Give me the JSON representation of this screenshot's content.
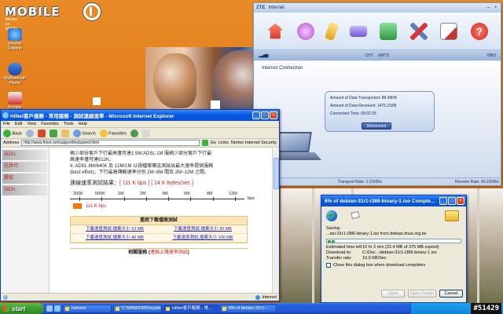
{
  "brand": {
    "logo_text": "MOBILE",
    "logo_sub": "Moves on Mobile"
  },
  "desktop_icons": [
    {
      "label": "Internet Explorer"
    },
    {
      "label": "MyBluetooth Places"
    },
    {
      "label": "Acrobat"
    }
  ],
  "zte": {
    "brand": "ZTE",
    "title": "Internet",
    "status": {
      "operator": "CHT",
      "network": "UMTS",
      "mode": "VIBO"
    },
    "section_label": "Internet Connection",
    "transported": "Amount of Data Transported: 88.48KB",
    "received": "Amount of Data Received: 1475.21KB",
    "time": "Connected Time: 00:02:25",
    "disconnect_label": "Disconnect",
    "footer": {
      "state": "Connected",
      "transport_rate": "Transport Rate: 1.21KB/s",
      "receive_rate": "Receive Rate: 49.23KB/s"
    }
  },
  "ie": {
    "title": "HiNet客戶服務 - 常用服務 - 測試連線速率 - Microsoft Internet Explorer",
    "menu": [
      "File",
      "Edit",
      "View",
      "Favorites",
      "Tools",
      "Help"
    ],
    "toolbar": {
      "back": "Back",
      "search": "Search",
      "favorites": "Favorites"
    },
    "address_label": "Address",
    "url": "http://www.hinet.net/support/testspeed.html",
    "go": "Go",
    "links": "Links",
    "norton": "Norton Internet Security",
    "sidebar": [
      "ADSL",
      "光世代",
      "撥接",
      "ISDN"
    ],
    "content": {
      "line1": "務少部份客戶下行最高僅可達1.5M;ADSL 1M 服務少部分客戶下行最",
      "line2": "高速率僅可達512K。",
      "line3": "4. ADSL 8M/640K 及 12M/1M 以視檔案傳送測試出最大速率提供服務",
      "line4": "(best effort)，下行最高傳輸速率分別 2M~8M 間及 2M~12M 之間。",
      "result_prefix": "連線速率測試結果：",
      "result_value": "[ 111 K bps ] [ 14 K bytes/sec ]",
      "scale_labels": [
        "200K",
        "500K",
        "1M",
        "2M",
        "3M",
        "5M",
        "8M",
        "12M"
      ],
      "scale_unit": "bps",
      "bar_label": "111 K bps",
      "bar_fraction": 0.05,
      "table_head": "重跑下載檔案測試",
      "table_rows": [
        [
          "下載速度測試,檔案大小 10 MB",
          "下載速度測試,檔案大小 20 MB"
        ],
        [
          "下載速度測試,檔案大小 40 MB",
          "下載速度測試,檔案大小 100 MB"
        ]
      ],
      "related_prefix": "相關服務 (",
      "related_link": "連線上傳速率測試",
      "related_suffix": ")"
    },
    "status": "Internet"
  },
  "download": {
    "title": "6% of debian-31r1-i386-binary-1.iso Comple...",
    "saving_label": "Saving:",
    "saving_file": "...ian-31r1-i386-binary-1.iso from debian.linux.org.tw",
    "progress": 0.06,
    "estimated_label": "Estimated time left",
    "estimated_value": "10 hr 2 min (22.4 MB of 375 MB copied)",
    "download_to_label": "Download to:",
    "download_to_value": "C:\\Doc...\\debian-31r1-i386-binary-1.iso",
    "rate_label": "Transfer rate:",
    "rate_value": "10.9 KB/Sec",
    "close_check": "Close this dialog box when download completes",
    "buttons": {
      "open": "Open",
      "open_folder": "Open Folder",
      "cancel": "Cancel"
    }
  },
  "taskbar": {
    "start": "start",
    "tasks": [
      "netcard",
      "C:\\WINDOWS\\syste...",
      "HiNet客戶服務 - 常...",
      "6% of debian-31r1-..."
    ],
    "watermark": "#51429"
  }
}
